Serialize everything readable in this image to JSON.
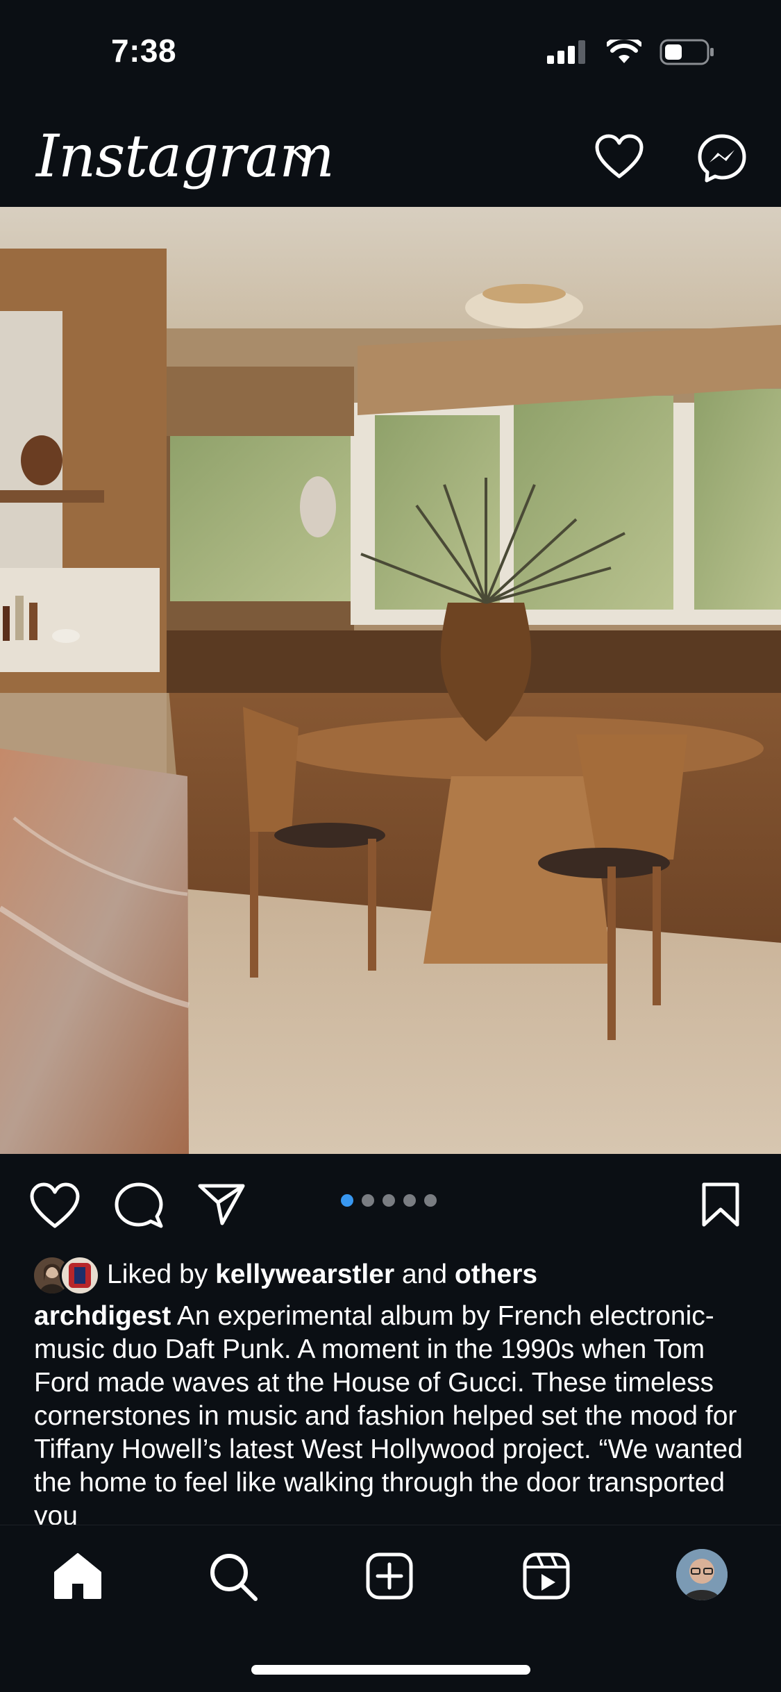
{
  "status_bar": {
    "time": "7:38",
    "signal": "cellular-signal-icon",
    "wifi": "wifi-icon",
    "battery": "battery-icon"
  },
  "header": {
    "logo_text": "Instagram",
    "dropdown_icon": "chevron-down-icon",
    "activity_icon": "heart-icon",
    "messenger_icon": "messenger-icon"
  },
  "post": {
    "image_alt": "dining nook with wooden table, chairs and vase",
    "carousel": {
      "count": 5,
      "active_index": 0
    },
    "likes": {
      "prefix": "Liked by",
      "user": "kellywearstler",
      "connector": "and",
      "others": "others"
    },
    "caption": {
      "username": "archdigest",
      "text": "An experimental album by French electronic-music duo Daft Punk. A moment in the 1990s when Tom Ford made waves at the House of Gucci. These timeless cornerstones in music and fashion helped set the mood for Tiffany Howell’s latest West Hollywood project. “We wanted the home to feel like walking through the door transported you"
    }
  },
  "tabbar": {
    "items": [
      "home-icon",
      "search-icon",
      "create-icon",
      "reels-icon",
      "profile-avatar"
    ]
  },
  "colors": {
    "background": "#0b0f14",
    "accent": "#3897f0"
  }
}
